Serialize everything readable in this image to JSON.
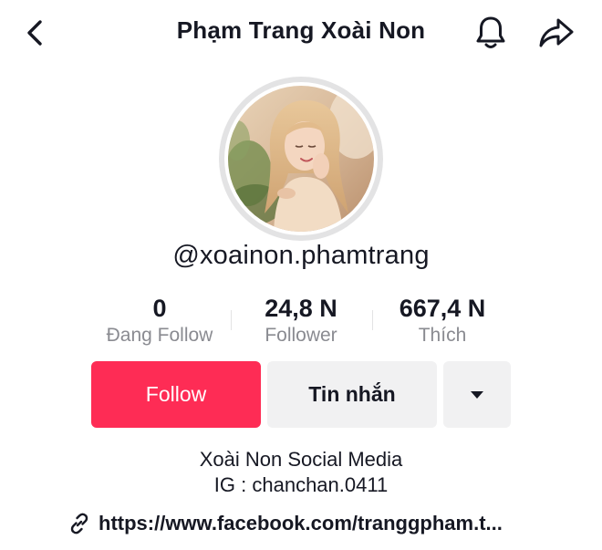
{
  "header": {
    "title": "Phạm Trang Xoài Non",
    "back_icon": "chevron-left-icon",
    "notification_icon": "bell-icon",
    "share_icon": "share-arrow-icon"
  },
  "profile": {
    "username": "@xoainon.phamtrang"
  },
  "stats": [
    {
      "value": "0",
      "label": "Đang Follow"
    },
    {
      "value": "24,8 N",
      "label": "Follower"
    },
    {
      "value": "667,4 N",
      "label": "Thích"
    }
  ],
  "actions": {
    "follow_label": "Follow",
    "message_label": "Tin nhắn",
    "more_icon": "caret-down-icon"
  },
  "bio": {
    "line1": "Xoài Non Social Media",
    "line2": "IG : chanchan.0411"
  },
  "link": {
    "icon": "link-icon",
    "text": "https://www.facebook.com/tranggpham.t..."
  },
  "colors": {
    "accent": "#fe2c55",
    "secondary_button": "#f1f1f2",
    "muted_text": "#8a8b91",
    "text": "#161823"
  }
}
